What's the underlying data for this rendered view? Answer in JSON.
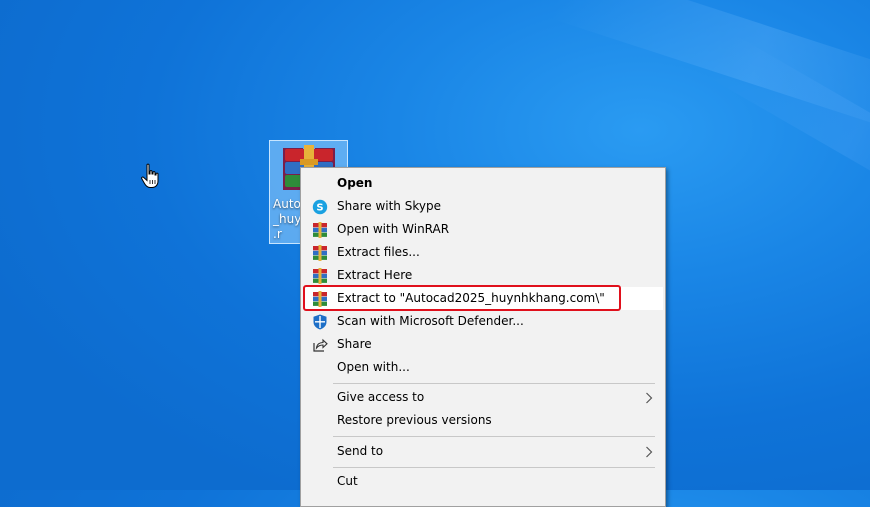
{
  "desktop": {
    "icon_label": "Auto\n_huy\n.r",
    "icon_name": "winrar-archive-icon"
  },
  "context_menu": {
    "items": [
      {
        "label": "Open",
        "icon": "none",
        "bold": true
      },
      {
        "label": "Share with Skype",
        "icon": "skype-icon"
      },
      {
        "label": "Open with WinRAR",
        "icon": "winrar-icon"
      },
      {
        "label": "Extract files...",
        "icon": "winrar-icon"
      },
      {
        "label": "Extract Here",
        "icon": "winrar-icon"
      },
      {
        "label": "Extract to \"Autocad2025_huynhkhang.com\\\"",
        "icon": "winrar-icon"
      },
      {
        "label": "Scan with Microsoft Defender...",
        "icon": "defender-shield-icon"
      },
      {
        "label": "Share",
        "icon": "share-icon"
      },
      {
        "label": "Open with...",
        "icon": "none"
      },
      {
        "label": "Give access to",
        "icon": "none",
        "submenu": true
      },
      {
        "label": "Restore previous versions",
        "icon": "none"
      },
      {
        "label": "Send to",
        "icon": "none",
        "submenu": true
      },
      {
        "label": "Cut",
        "icon": "none"
      }
    ]
  },
  "colors": {
    "highlight_border": "#e0101c",
    "desktop_blue": "#1a86e6"
  }
}
